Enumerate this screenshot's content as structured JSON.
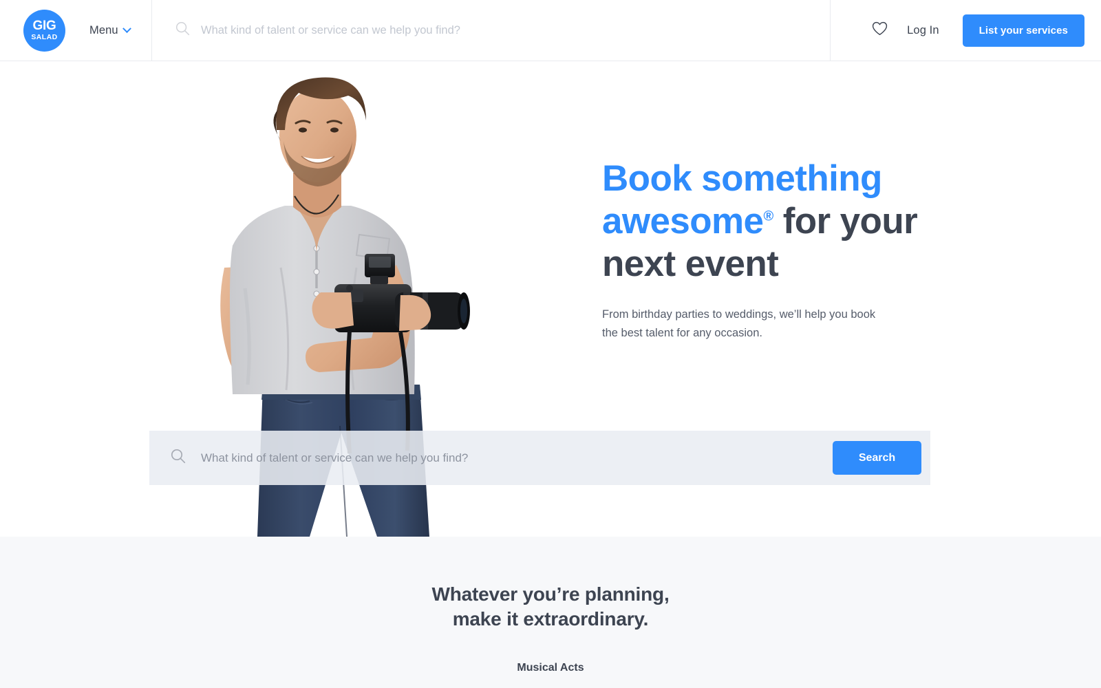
{
  "brand": {
    "logo_top": "GIG",
    "logo_bottom": "SALAD",
    "accent_color": "#2f8cfc",
    "text_color": "#3d4451"
  },
  "header": {
    "menu_label": "Menu",
    "search_placeholder": "What kind of talent or service can we help you find?",
    "search_value": "",
    "favorites_icon": "heart-icon",
    "login_label": "Log In",
    "cta_label": "List your services"
  },
  "hero": {
    "title_line1_accent": "Book something",
    "title_line2_accent": "awesome",
    "title_registered": "®",
    "title_line2_rest": " for your",
    "title_line3": "next event",
    "subtitle_line1": "From birthday parties to weddings, we’ll help you book",
    "subtitle_line2": "the best talent for any occasion.",
    "search_placeholder": "What kind of talent or service can we help you find?",
    "search_value": "",
    "search_button": "Search",
    "image_alt": "smiling-photographer-holding-dslr-camera",
    "searchbar_bg": "#e9edf3"
  },
  "lower": {
    "heading_line1": "Whatever you’re planning,",
    "heading_line2": "make it extraordinary.",
    "first_category": "Musical Acts",
    "background": "#f7f8fa"
  }
}
